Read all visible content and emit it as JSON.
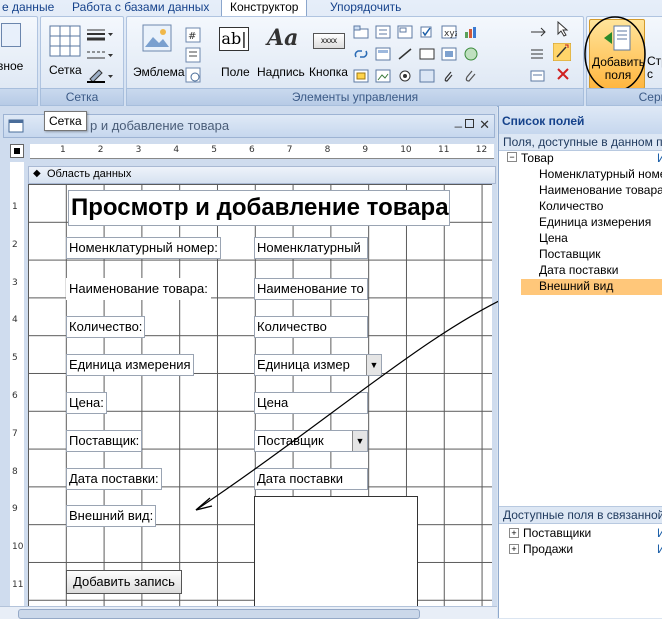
{
  "ribbon": {
    "tabs": [
      "е данные",
      "Работа с базами данных",
      "Конструктор",
      "Упорядочить"
    ],
    "groups": {
      "left_partial": "вное",
      "grid_button": "Сетка",
      "grid_group": "Сетка",
      "controls_group": "Элементы управления",
      "serv_partial": "Серв"
    },
    "buttons": {
      "emblem": "Эмблема",
      "field": "Поле",
      "caption": "Надпись",
      "button": "Кнопка",
      "button_icon_text": "xxxx",
      "add_fields_line1": "Добавить",
      "add_fields_line2": "поля",
      "partial_line1": "Стр",
      "partial_line2": "с"
    }
  },
  "tooltip": "Сетка",
  "window": {
    "title_partial": "р и добавление товара",
    "section": "Область данных",
    "ruler_top": [
      "1",
      "2",
      "3",
      "4",
      "5",
      "6",
      "7",
      "8",
      "9",
      "10",
      "11",
      "12"
    ],
    "ruler_left": [
      "1",
      "2",
      "3",
      "4",
      "5",
      "6",
      "7",
      "8",
      "9",
      "10",
      "11"
    ]
  },
  "form": {
    "heading": "Просмотр и добавление товара",
    "rows": [
      {
        "label": "Номенклатурный номер:",
        "field": "Номенклатурный"
      },
      {
        "label": "Наименование товара:",
        "field": "Наименование то"
      },
      {
        "label": "Количество:",
        "field": "Количество"
      },
      {
        "label": "Единица измерения",
        "field": "Единица измер"
      },
      {
        "label": "Цена:",
        "field": "Цена"
      },
      {
        "label": "Поставщик:",
        "field": "Поставщик"
      },
      {
        "label": "Дата поставки:",
        "field": "Дата поставки"
      },
      {
        "label": "Внешний вид:",
        "field": ""
      }
    ],
    "add_button": "Добавить запись",
    "combo_arrow": "▼"
  },
  "fieldlist": {
    "title": "Список полей",
    "available_label": "Поля, доступные в данном пр",
    "table": "Товар",
    "table_action": "И",
    "fields": [
      "Номенклатурный номе",
      "Наименование товара",
      "Количество",
      "Единица измерения",
      "Цена",
      "Поставщик",
      "Дата поставки",
      "Внешний вид"
    ],
    "related_label": "Доступные поля в связанной т",
    "related": [
      "Поставщики",
      "Продажи"
    ],
    "related_action": "И"
  },
  "colors": {
    "selected_field": "#ffc77a",
    "add_fields_highlight": "#ffb640"
  }
}
